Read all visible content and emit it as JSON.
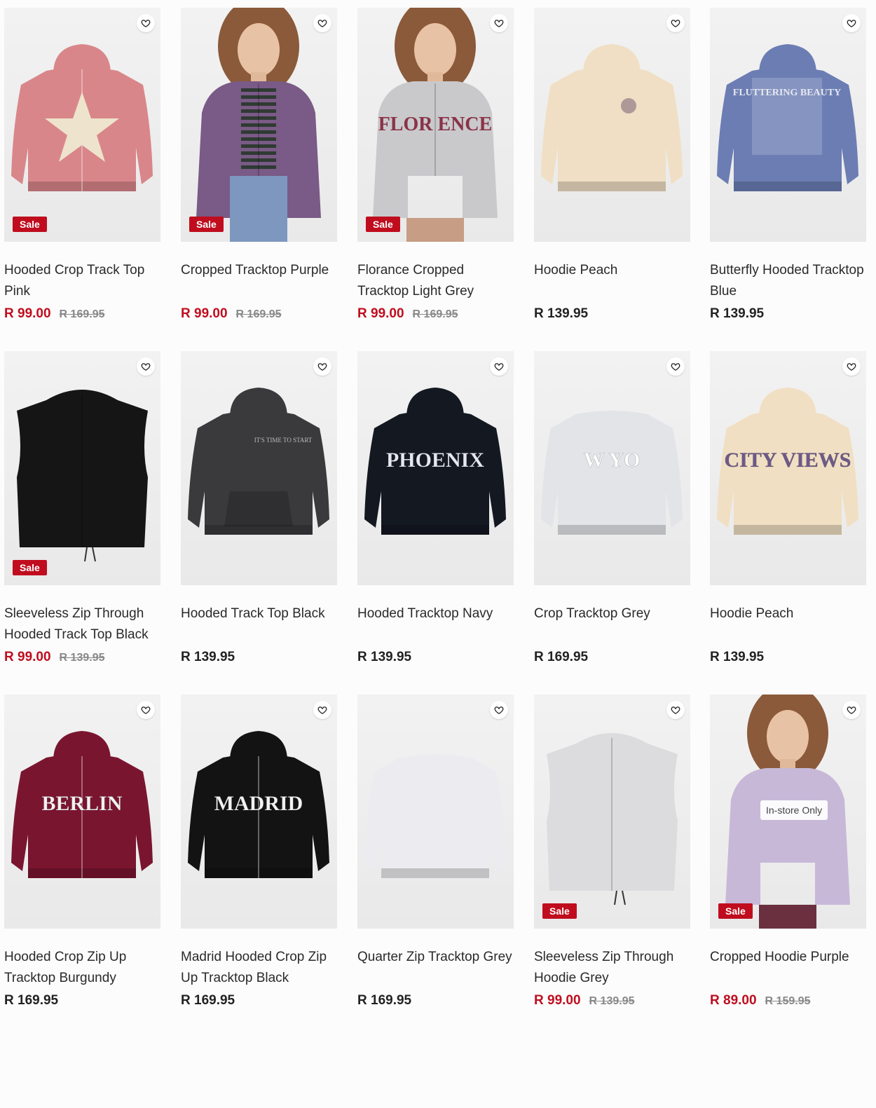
{
  "colors": {
    "sale": "#c00d1e",
    "text": "#222222",
    "was_price": "#888888"
  },
  "labels": {
    "sale": "Sale",
    "instore": "In-store Only"
  },
  "products": [
    {
      "title": "Hooded Crop Track Top Pink",
      "price": "R 99.00",
      "was": "R 169.95",
      "sale": true
    },
    {
      "title": "Cropped Tracktop Purple",
      "price": "R 99.00",
      "was": "R 169.95",
      "sale": true
    },
    {
      "title": "Florance Cropped Tracktop Light Grey",
      "price": "R 99.00",
      "was": "R 169.95",
      "sale": true
    },
    {
      "title": "Hoodie Peach",
      "price": "R 139.95",
      "was": "",
      "sale": false
    },
    {
      "title": "Butterfly Hooded Tracktop Blue",
      "price": "R 139.95",
      "was": "",
      "sale": false
    },
    {
      "title": "Sleeveless Zip Through Hooded Track Top Black",
      "price": "R 99.00",
      "was": "R 139.95",
      "sale": true
    },
    {
      "title": "Hooded Track Top Black",
      "price": "R 139.95",
      "was": "",
      "sale": false
    },
    {
      "title": "Hooded Tracktop Navy",
      "price": "R 139.95",
      "was": "",
      "sale": false
    },
    {
      "title": "Crop Tracktop Grey",
      "price": "R 169.95",
      "was": "",
      "sale": false
    },
    {
      "title": "Hoodie Peach",
      "price": "R 139.95",
      "was": "",
      "sale": false
    },
    {
      "title": "Hooded Crop Zip Up Tracktop Burgundy",
      "price": "R 169.95",
      "was": "",
      "sale": false
    },
    {
      "title": "Madrid Hooded Crop Zip Up Tracktop Black",
      "price": "R 169.95",
      "was": "",
      "sale": false
    },
    {
      "title": "Quarter Zip Tracktop Grey",
      "price": "R 169.95",
      "was": "",
      "sale": false
    },
    {
      "title": "Sleeveless Zip Through Hoodie Grey",
      "price": "R 99.00",
      "was": "R 139.95",
      "sale": true
    },
    {
      "title": "Cropped Hoodie Purple",
      "price": "R 89.00",
      "was": "R 159.95",
      "sale": true,
      "instore": true
    }
  ],
  "garments": [
    {
      "color": "#d9868a",
      "kind": "zip",
      "graphic": "star",
      "graphic_color": "#eee3cc"
    },
    {
      "color": "#7a5a86",
      "kind": "model-zip",
      "graphic": "stripes",
      "graphic_color": "#2f3a33"
    },
    {
      "color": "#c9c9cc",
      "kind": "model-zip",
      "graphic": "text",
      "graphic_color": "#8a3346",
      "graphic_text": "FLOR  ENCE"
    },
    {
      "color": "#f0dfc4",
      "kind": "hoodie",
      "graphic": "badge",
      "graphic_color": "#8f7b86"
    },
    {
      "color": "#6b7db3",
      "kind": "hoodie",
      "graphic": "print",
      "graphic_color": "#e6e8f0",
      "graphic_text": "FLUTTERING BEAUTY"
    },
    {
      "color": "#151515",
      "kind": "vest",
      "graphic": "none",
      "graphic_color": "#151515"
    },
    {
      "color": "#3a3a3c",
      "kind": "hoodie",
      "graphic": "small-text",
      "graphic_color": "#bbbbbb",
      "graphic_text": "IT'S TIME TO START"
    },
    {
      "color": "#141821",
      "kind": "hoodie",
      "graphic": "text",
      "graphic_color": "#e6e8f0",
      "graphic_text": "PHOENIX"
    },
    {
      "color": "#e3e4e8",
      "kind": "crew",
      "graphic": "text",
      "graphic_color": "#ffffff",
      "graphic_text": "W YO"
    },
    {
      "color": "#f1dfc3",
      "kind": "hoodie",
      "graphic": "text",
      "graphic_color": "#6d5a8a",
      "graphic_text": "CITY VIEWS"
    },
    {
      "color": "#7a1530",
      "kind": "zip",
      "graphic": "text",
      "graphic_color": "#f2f2f2",
      "graphic_text": "BERLIN"
    },
    {
      "color": "#131313",
      "kind": "zip",
      "graphic": "text",
      "graphic_color": "#f2f2f2",
      "graphic_text": "MADRID"
    },
    {
      "color": "#ececf0",
      "kind": "crew",
      "graphic": "none",
      "graphic_color": "#ececf0"
    },
    {
      "color": "#dcdcdf",
      "kind": "vest",
      "graphic": "none",
      "graphic_color": "#dcdcdf"
    },
    {
      "color": "#c7b8d8",
      "kind": "model-hoodie",
      "graphic": "none",
      "graphic_color": "#c7b8d8"
    }
  ]
}
